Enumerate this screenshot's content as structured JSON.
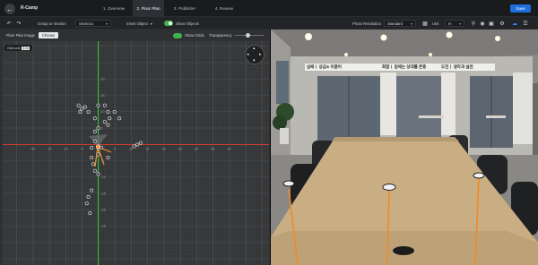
{
  "app": {
    "title": "R-Camp"
  },
  "steps": [
    {
      "label": "1. Overview",
      "active": false
    },
    {
      "label": "2. Floor Plan",
      "active": true
    },
    {
      "label": "3. Publisher",
      "active": false
    },
    {
      "label": "4. Review",
      "active": false
    }
  ],
  "actions": {
    "save_label": "Save"
  },
  "toolbar": {
    "group_label": "Group or Section",
    "group_value": "Section1",
    "insert_label": "Insert Object",
    "show_objects_label": "Show Objects",
    "photo_resolution_label": "Photo Resolution",
    "photo_resolution_value": "Standard",
    "unit_label": "Unit",
    "unit_value": "m"
  },
  "floorplan": {
    "image_label": "Floor Plan Image",
    "choose_label": "Choose",
    "show_grids_label": "Show Grids",
    "transparency_label": "Transparency",
    "grid_unit_label": "Grid unit",
    "grid_unit_value": "1 m",
    "x_ticks": [
      "-20",
      "-15",
      "-10",
      "-5",
      "0",
      "5",
      "10",
      "15",
      "20",
      "25",
      "30",
      "35",
      "40"
    ],
    "y_ticks": [
      "20",
      "15",
      "10",
      "5",
      "0",
      "-5",
      "-10",
      "-15",
      "-20",
      "-25"
    ]
  },
  "panorama": {
    "sign_left": "심때ㅣ 상금& 이끌어",
    "sign_center": "화합ㅣ 일에는 상대를 존중",
    "sign_right": "도전ㅣ 생각과 실천"
  }
}
